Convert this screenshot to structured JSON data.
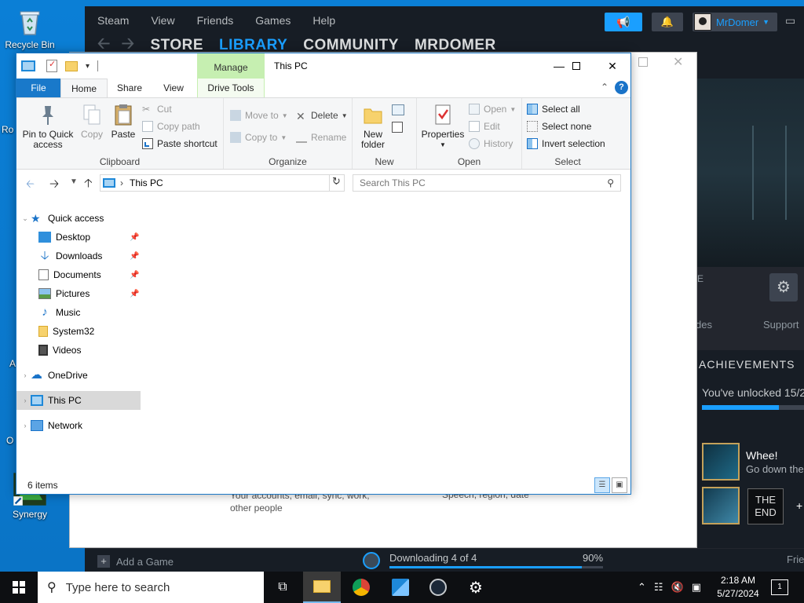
{
  "desktop": {
    "icons": [
      {
        "label": "Recycle Bin"
      },
      {
        "label": "Synergy"
      }
    ],
    "edge_labels": [
      "Ro",
      "A",
      "O"
    ]
  },
  "steam": {
    "menu": [
      "Steam",
      "View",
      "Friends",
      "Games",
      "Help"
    ],
    "nav": [
      "STORE",
      "LIBRARY",
      "COMMUNITY",
      "MRDOMER"
    ],
    "active_nav": "LIBRARY",
    "username": "MrDomer",
    "section_letter": "E",
    "tabs_partial": [
      "des",
      "Support"
    ],
    "achievements_title": "ACHIEVEMENTS",
    "unlocked_text": "You've unlocked 15/2",
    "unlocked_fraction": 0.75,
    "achievement_name": "Whee!",
    "achievement_desc": "Go down the",
    "end_badge": "THE END",
    "more_symbol": "+",
    "add_game": "Add a Game",
    "download_status": "Downloading 4 of 4",
    "download_pct": "90%",
    "download_fraction": 0.9,
    "friends": "Frie"
  },
  "settings_behind": {
    "desc_left": "Your accounts, email, sync, work, other people",
    "desc_right": "Speech, region, date"
  },
  "explorer": {
    "title": "This PC",
    "context_tab": "Manage",
    "tabs": [
      "File",
      "Home",
      "Share",
      "View",
      "Drive Tools"
    ],
    "ribbon": {
      "clipboard": {
        "label": "Clipboard",
        "pin": "Pin to Quick access",
        "copy": "Copy",
        "paste": "Paste",
        "cut": "Cut",
        "copy_path": "Copy path",
        "paste_shortcut": "Paste shortcut"
      },
      "organize": {
        "label": "Organize",
        "move_to": "Move to",
        "copy_to": "Copy to",
        "delete": "Delete",
        "rename": "Rename"
      },
      "new": {
        "label": "New",
        "new_folder": "New folder"
      },
      "open": {
        "label": "Open",
        "properties": "Properties",
        "open": "Open",
        "edit": "Edit",
        "history": "History"
      },
      "select": {
        "label": "Select",
        "select_all": "Select all",
        "select_none": "Select none",
        "invert": "Invert selection"
      }
    },
    "address": "This PC",
    "search_placeholder": "Search This PC",
    "nav": {
      "quick_access": "Quick access",
      "items": [
        "Desktop",
        "Downloads",
        "Documents",
        "Pictures",
        "Music",
        "System32",
        "Videos"
      ],
      "onedrive": "OneDrive",
      "this_pc": "This PC",
      "network": "Network"
    },
    "status": "6 items"
  },
  "taskbar": {
    "search_placeholder": "Type here to search",
    "time": "2:18 AM",
    "date": "5/27/2024",
    "notification_count": "1"
  },
  "colors": {
    "steam_blue": "#1a9fff",
    "file_tab": "#1979ca",
    "manage_green": "#c6efb1",
    "desktop_blue": "#0a7bd0"
  }
}
